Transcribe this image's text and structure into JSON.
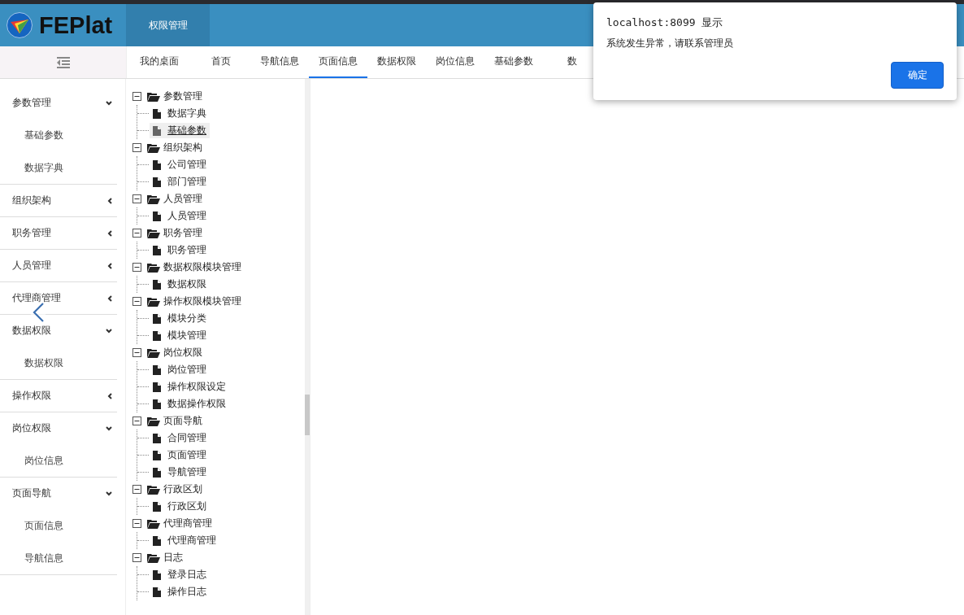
{
  "header": {
    "logo_text": "FEPlat",
    "module_tab": "权限管理"
  },
  "tabs": [
    {
      "label": "我的桌面",
      "selected": false
    },
    {
      "label": "首页",
      "selected": false
    },
    {
      "label": "导航信息",
      "selected": false
    },
    {
      "label": "页面信息",
      "selected": true
    },
    {
      "label": "数据权限",
      "selected": false
    },
    {
      "label": "岗位信息",
      "selected": false
    },
    {
      "label": "基础参数",
      "selected": false
    },
    {
      "label": "数",
      "selected": false
    }
  ],
  "sidebar": [
    {
      "label": "参数管理",
      "expanded": true,
      "children": [
        {
          "label": "基础参数"
        },
        {
          "label": "数据字典"
        }
      ]
    },
    {
      "label": "组织架构",
      "expanded": false
    },
    {
      "label": "职务管理",
      "expanded": false
    },
    {
      "label": "人员管理",
      "expanded": false
    },
    {
      "label": "代理商管理",
      "expanded": false
    },
    {
      "label": "数据权限",
      "expanded": true,
      "children": [
        {
          "label": "数据权限"
        }
      ]
    },
    {
      "label": "操作权限",
      "expanded": false
    },
    {
      "label": "岗位权限",
      "expanded": true,
      "children": [
        {
          "label": "岗位信息"
        }
      ]
    },
    {
      "label": "页面导航",
      "expanded": true,
      "children": [
        {
          "label": "页面信息"
        },
        {
          "label": "导航信息"
        }
      ]
    }
  ],
  "tree": [
    {
      "label": "参数管理",
      "expanded": true,
      "children": [
        {
          "label": "数据字典",
          "selected": false
        },
        {
          "label": "基础参数",
          "selected": true
        }
      ]
    },
    {
      "label": "组织架构",
      "expanded": true,
      "children": [
        {
          "label": "公司管理",
          "selected": false
        },
        {
          "label": "部门管理",
          "selected": false
        }
      ]
    },
    {
      "label": "人员管理",
      "expanded": true,
      "children": [
        {
          "label": "人员管理",
          "selected": false
        }
      ]
    },
    {
      "label": "职务管理",
      "expanded": true,
      "children": [
        {
          "label": "职务管理",
          "selected": false
        }
      ]
    },
    {
      "label": "数据权限模块管理",
      "expanded": true,
      "children": [
        {
          "label": "数据权限",
          "selected": false
        }
      ]
    },
    {
      "label": "操作权限模块管理",
      "expanded": true,
      "children": [
        {
          "label": "模块分类",
          "selected": false
        },
        {
          "label": "模块管理",
          "selected": false
        }
      ]
    },
    {
      "label": "岗位权限",
      "expanded": true,
      "children": [
        {
          "label": "岗位管理",
          "selected": false
        },
        {
          "label": "操作权限设定",
          "selected": false
        },
        {
          "label": "数据操作权限",
          "selected": false
        }
      ]
    },
    {
      "label": "页面导航",
      "expanded": true,
      "children": [
        {
          "label": "合同管理",
          "selected": false
        },
        {
          "label": "页面管理",
          "selected": false
        },
        {
          "label": "导航管理",
          "selected": false
        }
      ]
    },
    {
      "label": "行政区划",
      "expanded": true,
      "children": [
        {
          "label": "行政区划",
          "selected": false
        }
      ]
    },
    {
      "label": "代理商管理",
      "expanded": true,
      "children": [
        {
          "label": "代理商管理",
          "selected": false
        }
      ]
    },
    {
      "label": "日志",
      "expanded": true,
      "children": [
        {
          "label": "登录日志",
          "selected": false
        },
        {
          "label": "操作日志",
          "selected": false
        }
      ]
    }
  ],
  "dialog": {
    "title": "localhost:8099 显示",
    "message": "系统发生异常，请联系管理员",
    "button": "确定"
  }
}
